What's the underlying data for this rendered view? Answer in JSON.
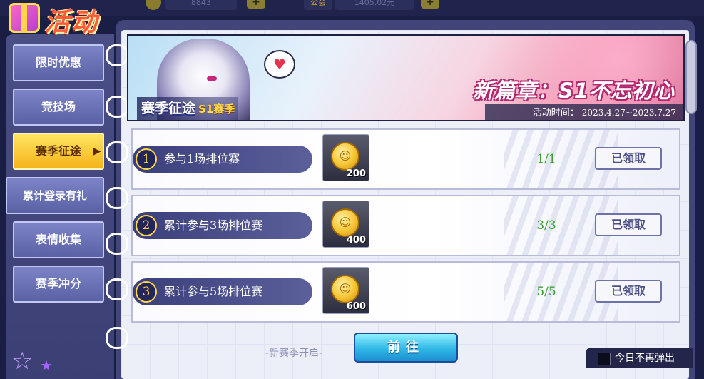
{
  "colors": {
    "accent_yellow": "#f5b21a",
    "progress_green": "#3aa12e",
    "panel_bg": "#42457a",
    "go_button": "#2fb7e6"
  },
  "topbar": {
    "currency1_value": "8843",
    "currency2_label": "公会",
    "currency2_value": "1405.02元"
  },
  "logo": {
    "title": "活动",
    "icon": "gift-box-icon"
  },
  "sidebar": {
    "tabs": [
      {
        "label": "限时优惠",
        "active": false
      },
      {
        "label": "竞技场",
        "active": false
      },
      {
        "label": "赛季征途",
        "active": true
      },
      {
        "label": "累计登录有礼",
        "active": false
      },
      {
        "label": "表情收集",
        "active": false
      },
      {
        "label": "赛季冲分",
        "active": false
      }
    ]
  },
  "banner": {
    "tag_main": "赛季征途",
    "tag_season": "S1赛季",
    "headline": "新篇章：S1不忘初心",
    "time_label": "活动时间：",
    "time_value": "2023.4.27~2023.7.27",
    "bubble_icon": "heart-icon"
  },
  "tasks": [
    {
      "num": "1",
      "label": "参与1场排位赛",
      "reward_amount": "200",
      "progress": "1/1",
      "button": "已领取"
    },
    {
      "num": "2",
      "label": "累计参与3场排位赛",
      "reward_amount": "400",
      "progress": "3/3",
      "button": "已领取"
    },
    {
      "num": "3",
      "label": "累计参与5场排位赛",
      "reward_amount": "600",
      "progress": "5/5",
      "button": "已领取"
    }
  ],
  "footer": {
    "season_hint": "-新赛季开启-",
    "go_button": "前往",
    "no_popup_label": "今日不再弹出"
  }
}
